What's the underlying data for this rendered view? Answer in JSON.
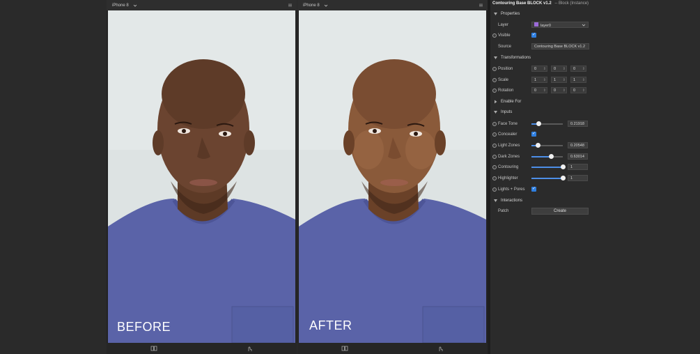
{
  "viewports": [
    {
      "device": "iPhone 8",
      "label": "BEFORE"
    },
    {
      "device": "iPhone 8",
      "label": "AFTER"
    }
  ],
  "panel": {
    "title": "Contouring Base BLOCK v1.2",
    "subtitle": "-- Block (Instance)",
    "properties": {
      "section": "Properties",
      "layer_label": "Layer",
      "layer_value": "layer0",
      "visible_label": "Visible",
      "source_label": "Source",
      "source_value": "Contouring Base BLOCK v1.2"
    },
    "transformations": {
      "section": "Transformations",
      "position_label": "Position",
      "position": [
        "0",
        "0",
        "0"
      ],
      "scale_label": "Scale",
      "scale": [
        "1",
        "1",
        "1"
      ],
      "rotation_label": "Rotation",
      "rotation": [
        "0",
        "0",
        "0"
      ]
    },
    "enable_for": {
      "section": "Enable For"
    },
    "inputs": {
      "section": "Inputs",
      "face_tone_label": "Face Tone",
      "face_tone_value": "0.21918",
      "face_tone_level": 0.21918,
      "concealer_label": "Concealer",
      "light_zones_label": "Light Zones",
      "light_zones_value": "0.20548",
      "light_zones_level": 0.20548,
      "dark_zones_label": "Dark Zones",
      "dark_zones_value": "0.63014",
      "dark_zones_level": 0.63014,
      "contouring_label": "Contouring",
      "contouring_value": "1",
      "contouring_level": 1,
      "highlighter_label": "Highlighter",
      "highlighter_value": "1",
      "highlighter_level": 1,
      "lights_pores_label": "Lights + Pores"
    },
    "interactions": {
      "section": "Interactions",
      "patch_label": "Patch",
      "create_label": "Create"
    }
  },
  "colors": {
    "accent": "#2f7fe0",
    "layer_swatch": "#9c6bd8",
    "shirt": "#5a63a8",
    "background": "#dde3e3"
  }
}
